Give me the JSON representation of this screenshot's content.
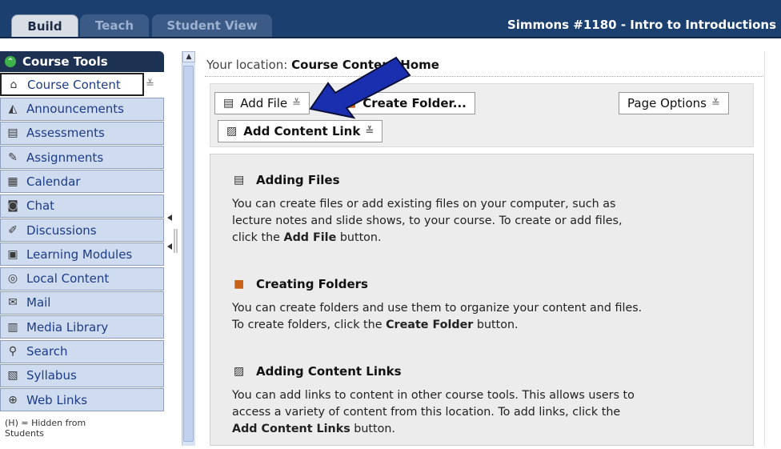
{
  "header": {
    "tabs": [
      "Build",
      "Teach",
      "Student View"
    ],
    "course_title": "Simmons #1180 - Intro to Introductions"
  },
  "sidebar": {
    "title": "Course Tools",
    "items": [
      {
        "label": "Course Content",
        "icon": "home-icon"
      },
      {
        "label": "Announcements",
        "icon": "megaphone-icon"
      },
      {
        "label": "Assessments",
        "icon": "assessment-icon"
      },
      {
        "label": "Assignments",
        "icon": "assignment-icon"
      },
      {
        "label": "Calendar",
        "icon": "calendar-icon"
      },
      {
        "label": "Chat",
        "icon": "chat-icon"
      },
      {
        "label": "Discussions",
        "icon": "pin-icon"
      },
      {
        "label": "Learning Modules",
        "icon": "module-icon"
      },
      {
        "label": "Local Content",
        "icon": "local-content-icon"
      },
      {
        "label": "Mail",
        "icon": "mail-icon"
      },
      {
        "label": "Media Library",
        "icon": "media-icon"
      },
      {
        "label": "Search",
        "icon": "search-icon"
      },
      {
        "label": "Syllabus",
        "icon": "syllabus-icon"
      },
      {
        "label": "Web Links",
        "icon": "web-links-icon"
      }
    ],
    "hidden_note": "(H) = Hidden from Students"
  },
  "location": {
    "label": "Your location:",
    "value": "Course Content Home"
  },
  "toolbar": {
    "add_file": "Add File",
    "create_folder": "Create Folder...",
    "page_options": "Page Options",
    "add_content_link": "Add Content Link"
  },
  "sections": [
    {
      "title": "Adding Files",
      "pre": "You can create files or add existing files on your computer, such as lecture notes and slide shows, to your course. To create or add files, click the ",
      "bold": "Add File",
      "post": " button."
    },
    {
      "title": "Creating Folders",
      "pre": "You can create folders and use them to organize your content and files. To create folders, click the ",
      "bold": "Create Folder",
      "post": " button."
    },
    {
      "title": "Adding Content Links",
      "pre": "You can add links to content in other course tools. This allows users to access a variety of content from this location. To add links, click the ",
      "bold": "Add Content Links",
      "post": " button."
    }
  ],
  "colors": {
    "header_bg": "#1b3f6e",
    "nav_bg": "#cfdbef",
    "arrow": "#1a2fb0"
  }
}
